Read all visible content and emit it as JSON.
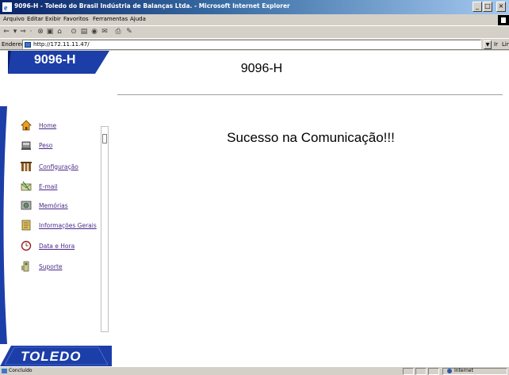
{
  "window": {
    "title": "9096-H - Toledo do Brasil Indústria de Balanças Ltda. - Microsoft Internet Explorer",
    "controls": [
      "_",
      "□",
      "×"
    ]
  },
  "menu": [
    "Arquivo",
    "Editar",
    "Exibir",
    "Favoritos",
    "Ferramentas",
    "Ajuda"
  ],
  "toolbar_icons": [
    "back-icon",
    "forward-icon",
    "stop-icon",
    "refresh-icon",
    "home-icon",
    "search-icon",
    "favorites-icon",
    "history-icon",
    "mail-icon",
    "print-icon"
  ],
  "address": {
    "label": "Endereço",
    "url": "http://172.11.11.47/",
    "go": "Ir",
    "links": "Links"
  },
  "left": {
    "model": "9096-H",
    "brand": "TOLEDO",
    "nav": [
      {
        "label": "Home",
        "icon": "home-icon"
      },
      {
        "label": "Peso",
        "icon": "scale-icon"
      },
      {
        "label": "Configuração",
        "icon": "config-icon"
      },
      {
        "label": "E-mail",
        "icon": "email-icon"
      },
      {
        "label": "Memórias",
        "icon": "memory-icon"
      },
      {
        "label": "Informações Gerais",
        "icon": "info-icon"
      },
      {
        "label": "Data e Hora",
        "icon": "clock-icon"
      },
      {
        "label": "Suporte",
        "icon": "support-icon"
      }
    ]
  },
  "main": {
    "heading": "9096-H",
    "message": "Sucesso na Comunicação!!!"
  },
  "status": {
    "text": "Concluído",
    "zone": "Internet"
  },
  "colors": {
    "brand_blue": "#1c3ea8",
    "link": "#4a2a8a",
    "chrome": "#d4d0c8"
  }
}
